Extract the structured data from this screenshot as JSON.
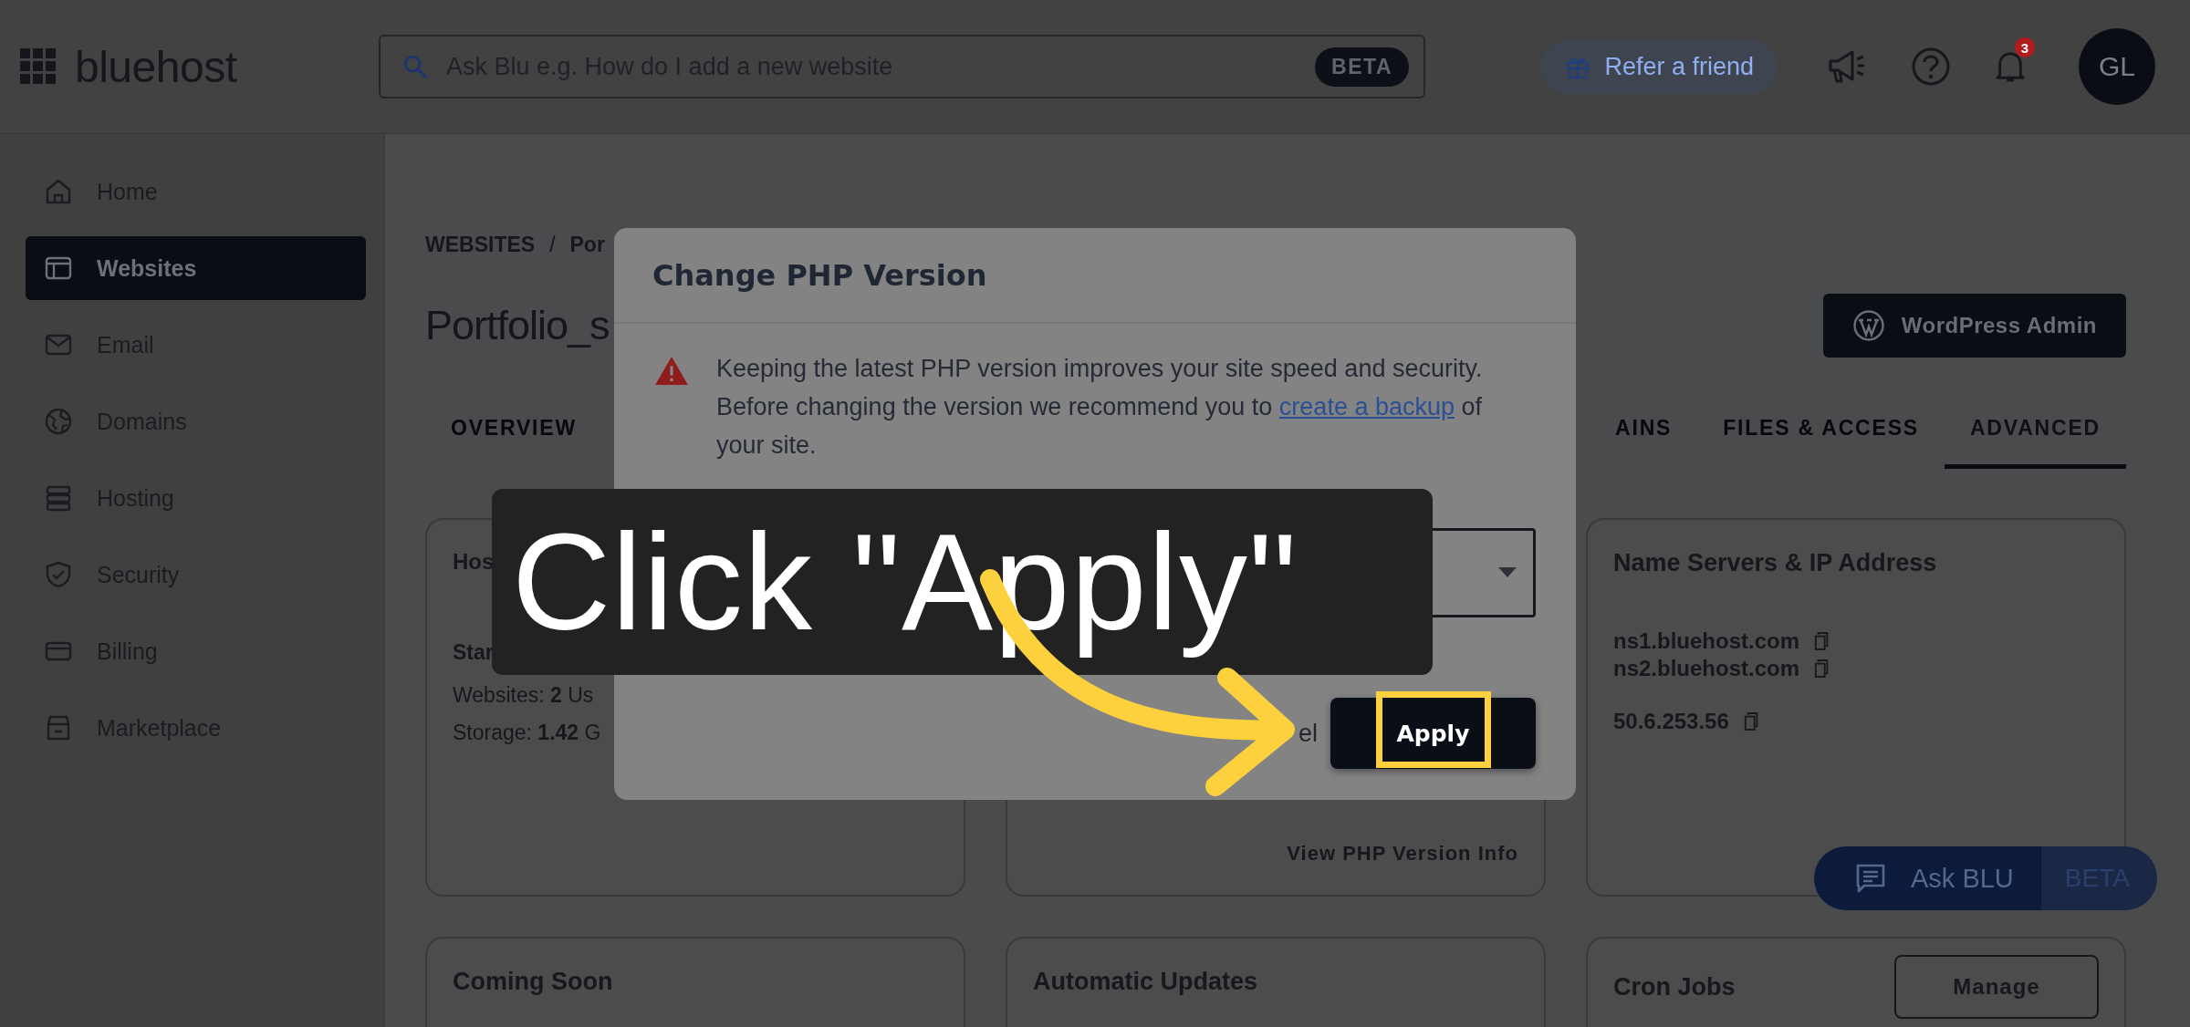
{
  "header": {
    "logo": "bluehost",
    "search": {
      "placeholder": "Ask Blu e.g. How do I add a new website",
      "badge": "BETA"
    },
    "refer": "Refer a friend",
    "notifications": "3",
    "avatar": "GL"
  },
  "sidebar": {
    "items": [
      {
        "label": "Home",
        "selected": false
      },
      {
        "label": "Websites",
        "selected": true
      },
      {
        "label": "Email",
        "selected": false
      },
      {
        "label": "Domains",
        "selected": false
      },
      {
        "label": "Hosting",
        "selected": false
      },
      {
        "label": "Security",
        "selected": false
      },
      {
        "label": "Billing",
        "selected": false
      },
      {
        "label": "Marketplace",
        "selected": false
      }
    ]
  },
  "breadcrumb": {
    "section": "WEBSITES",
    "separator": "/",
    "current": "Por"
  },
  "site_title": "Portfolio_s",
  "wp_button": "WordPress Admin",
  "tabs": [
    {
      "label": "OVERVIEW",
      "selected": false
    },
    {
      "label": "AINS",
      "selected": false
    },
    {
      "label": "FILES & ACCESS",
      "selected": false
    },
    {
      "label": "ADVANCED",
      "selected": true
    }
  ],
  "hosting_plan": {
    "title": "Hos",
    "plan": "Star",
    "websites": "Websites: **2** Us",
    "storage": "Storage: **1.42** G"
  },
  "php_card": {
    "link": "View PHP Version Info"
  },
  "name_servers": {
    "title": "Name Servers & IP Address",
    "servers": [
      "ns1.bluehost.com",
      "ns2.bluehost.com"
    ],
    "ip": "50.6.253.56"
  },
  "coming_soon": {
    "title": "Coming Soon"
  },
  "automatic_updates": {
    "title": "Automatic Updates"
  },
  "cron_jobs": {
    "title": "Cron Jobs",
    "button": "Manage"
  },
  "ask_blu": {
    "label": "Ask BLU",
    "badge": "BETA"
  },
  "modal": {
    "title": "Change PHP Version",
    "message_before": "Keeping the latest PHP version improves your site speed and security. Before changing the version we recommend you to ",
    "link": "create a backup",
    "message_after": " of your site.",
    "cancel": "el",
    "apply": "Apply"
  },
  "caption": "Click \"Apply\""
}
